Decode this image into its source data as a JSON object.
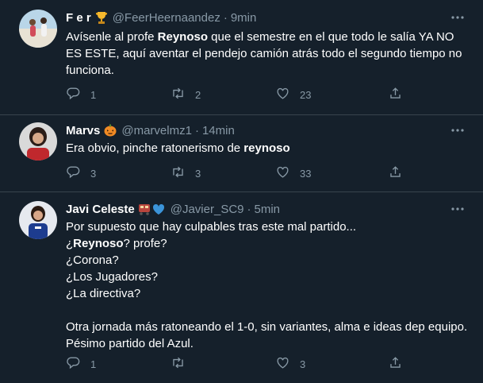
{
  "tweets": [
    {
      "name": "F e r",
      "name_emoji": "trophy-emoji",
      "handle": "@FeerHeernaandez",
      "separator": "·",
      "time": "9min",
      "text_parts": [
        "Avísenle al profe ",
        "Reynoso",
        " que el semestre en el que todo le salía YA NO ES ESTE, aquí aventar el pendejo camión atrás todo el segundo tiempo no funciona."
      ],
      "replies": "1",
      "retweets": "2",
      "likes": "23"
    },
    {
      "name": "Marvs",
      "name_emoji": "pumpkin-emoji",
      "handle": "@marvelmz1",
      "separator": "·",
      "time": "14min",
      "text_parts": [
        "Era obvio, pinche ratonerismo de ",
        "reynoso",
        ""
      ],
      "replies": "3",
      "retweets": "3",
      "likes": "33"
    },
    {
      "name": "Javi Celeste",
      "name_emoji": "train-and-heart-emoji",
      "handle": "@Javier_SC9",
      "separator": "·",
      "time": "5min",
      "lines": {
        "l1": "Por supuesto que hay culpables tras este mal partido...",
        "l2_prefix": "¿",
        "l2_bold": "Reynoso",
        "l2_suffix": "? profe?",
        "l3": "¿Corona?",
        "l4": "¿Los Jugadores?",
        "l5": "¿La directiva?",
        "l6": "Otra jornada más ratoneando el 1-0, sin variantes, alma e ideas dep equipo.",
        "l7": "Pésimo partido del Azul."
      },
      "replies": "1",
      "retweets": "",
      "likes": "3"
    }
  ],
  "icons": {
    "reply": "reply-icon",
    "retweet": "retweet-icon",
    "like": "heart-icon",
    "share": "share-icon",
    "more": "more-icon"
  },
  "colors": {
    "background": "#15202b",
    "divider": "#38444d",
    "secondary_text": "#8899a6",
    "heart": "#1d9bf0"
  }
}
